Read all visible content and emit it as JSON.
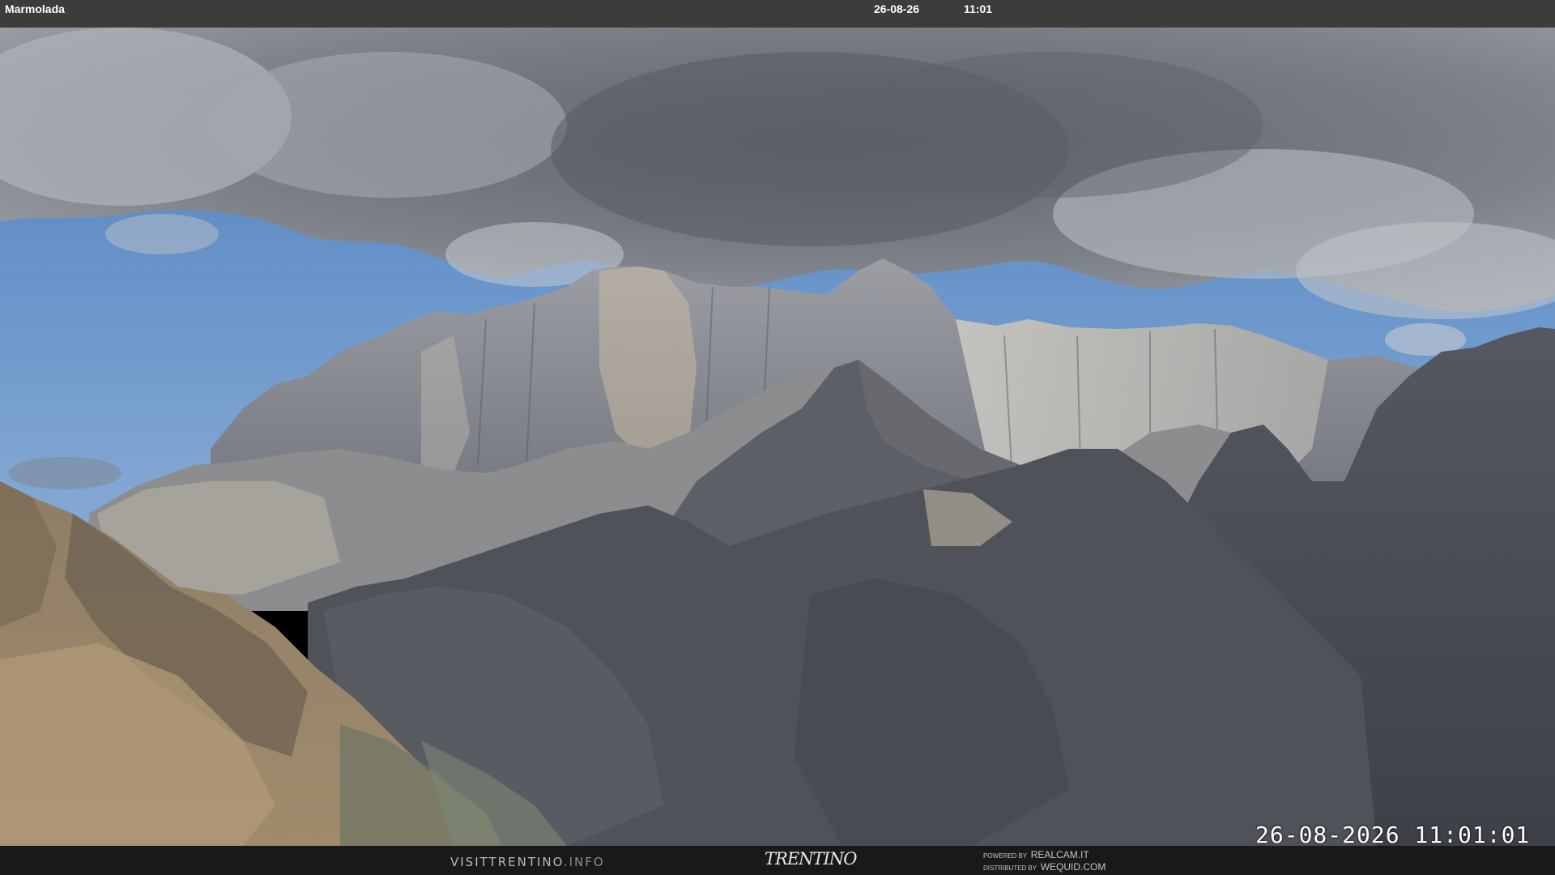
{
  "header": {
    "location": "Marmolada",
    "date": "26-08-26",
    "time": "11:01"
  },
  "overlay": {
    "timestamp": "26-08-2026 11:01:01"
  },
  "footer": {
    "site": "VISITTRENTINO",
    "site_suffix": ".INFO",
    "brand": "TRENTINO",
    "powered_prefix": "POWERED BY",
    "powered_name": "REALCAM.IT",
    "distributed_prefix": "DISTRIBUTED BY",
    "distributed_name": "WEQUID.COM"
  },
  "colors": {
    "sky": "#5b88c2",
    "cloud": "#7b7f86",
    "rock_light": "#b9b9b6",
    "rock_dark": "#4a4d55",
    "scree": "#a48c6c"
  }
}
